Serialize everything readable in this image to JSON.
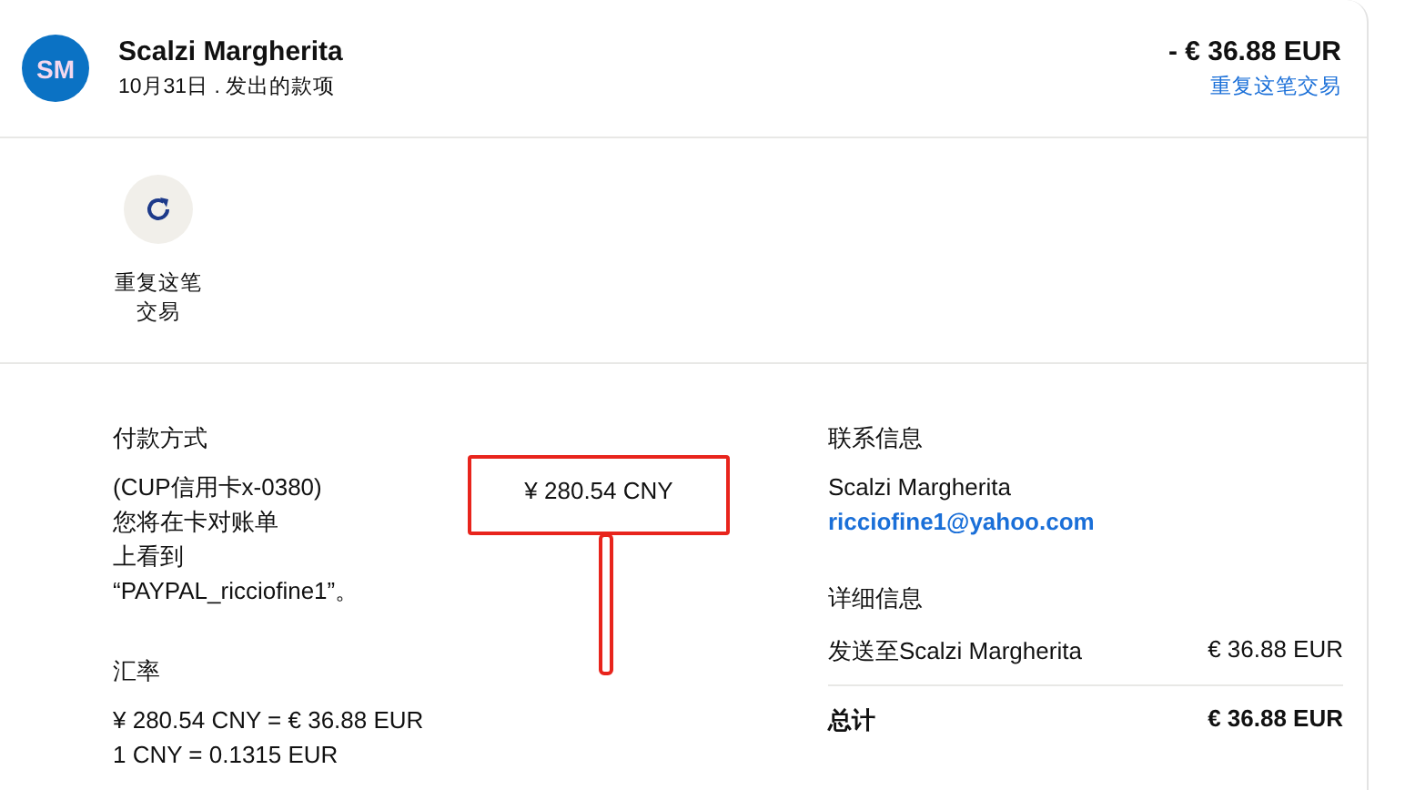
{
  "header": {
    "avatar": "SM",
    "name": "Scalzi Margherita",
    "subtitle": "10月31日 . 发出的款项",
    "amount": "- € 36.88 EUR",
    "link": "重复这笔交易"
  },
  "actions": [
    {
      "label": "重复这笔交易"
    }
  ],
  "payment": {
    "title": "付款方式",
    "lines": [
      "(CUP信用卡x-0380)",
      "您将在卡对账单",
      "上看到",
      "“PAYPAL_ricciofine1”。"
    ],
    "amount": "¥ 280.54 CNY",
    "highlighted": true
  },
  "exchange": {
    "title": "汇率",
    "lines": [
      "¥ 280.54 CNY = € 36.88 EUR",
      "1 CNY = 0.1315 EUR"
    ]
  },
  "contact": {
    "title": "联系信息",
    "name": "Scalzi Margherita",
    "email": "ricciofine1@yahoo.com"
  },
  "details": {
    "title": "详细信息",
    "rows": [
      {
        "label": "发送至Scalzi Margherita",
        "value": "€ 36.88 EUR"
      }
    ],
    "total": {
      "label": "总计",
      "value": "€ 36.88 EUR"
    }
  }
}
